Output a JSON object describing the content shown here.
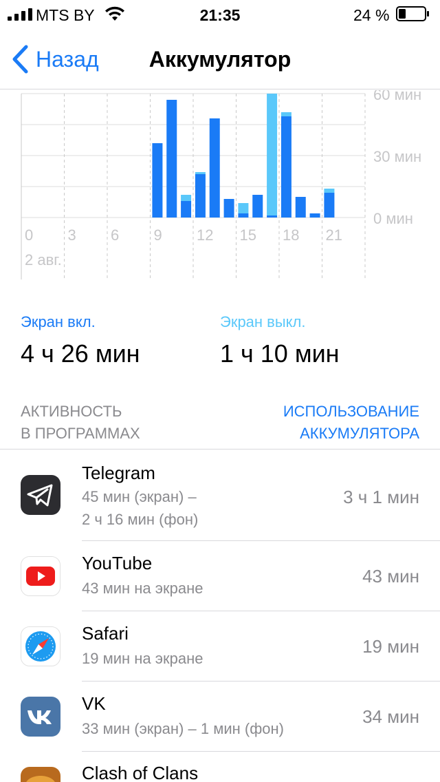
{
  "status_bar": {
    "carrier": "MTS BY",
    "time": "21:35",
    "battery_percent": "24 %"
  },
  "nav": {
    "back_label": "Назад",
    "title": "Аккумулятор"
  },
  "chart_data": {
    "type": "bar",
    "stacked": true,
    "x": [
      0,
      1,
      2,
      3,
      4,
      5,
      6,
      7,
      8,
      9,
      10,
      11,
      12,
      13,
      14,
      15,
      16,
      17,
      18,
      19,
      20,
      21,
      22,
      23
    ],
    "x_tick_labels": [
      "0",
      "3",
      "6",
      "9",
      "12",
      "15",
      "18",
      "21"
    ],
    "x_sublabel": "2 авг.",
    "y_tick_labels": [
      "0 мин",
      "30 мин",
      "60 мин"
    ],
    "ylim": [
      0,
      60
    ],
    "series": [
      {
        "color": "#1a7bf6",
        "values": [
          0,
          0,
          0,
          0,
          0,
          0,
          0,
          0,
          0,
          36,
          57,
          8,
          21,
          48,
          9,
          2,
          11,
          1,
          49,
          10,
          2,
          12,
          0,
          0
        ]
      },
      {
        "color": "#5ac8fa",
        "values": [
          0,
          0,
          0,
          0,
          0,
          0,
          0,
          0,
          0,
          0,
          0,
          3,
          1,
          0,
          0,
          5,
          0,
          59,
          2,
          0,
          0,
          2,
          0,
          0
        ]
      }
    ],
    "grid": true
  },
  "screen": {
    "on_label": "Экран вкл.",
    "on_value": "4 ч 26 мин",
    "off_label": "Экран выкл.",
    "off_value": "1 ч 10 мин"
  },
  "section": {
    "left_line1": "АКТИВНОСТЬ",
    "left_line2": "В ПРОГРАММАХ",
    "right_line1": "ИСПОЛЬЗОВАНИЕ",
    "right_line2": "АККУМУЛЯТОРА"
  },
  "apps": [
    {
      "name": "Telegram",
      "sub1": "45 мин (экран) –",
      "sub2": "2 ч 16 мин (фон)",
      "usage": "3 ч 1 мин",
      "icon": "telegram-icon"
    },
    {
      "name": "YouTube",
      "sub1": "43 мин на экране",
      "usage": "43 мин",
      "icon": "youtube-icon"
    },
    {
      "name": "Safari",
      "sub1": "19 мин на экране",
      "usage": "19 мин",
      "icon": "safari-icon"
    },
    {
      "name": "VK",
      "sub1": "33 мин (экран) – 1 мин (фон)",
      "usage": "34 мин",
      "icon": "vk-icon"
    },
    {
      "name": "Clash of Clans",
      "icon": "clash-of-clans-icon"
    }
  ]
}
